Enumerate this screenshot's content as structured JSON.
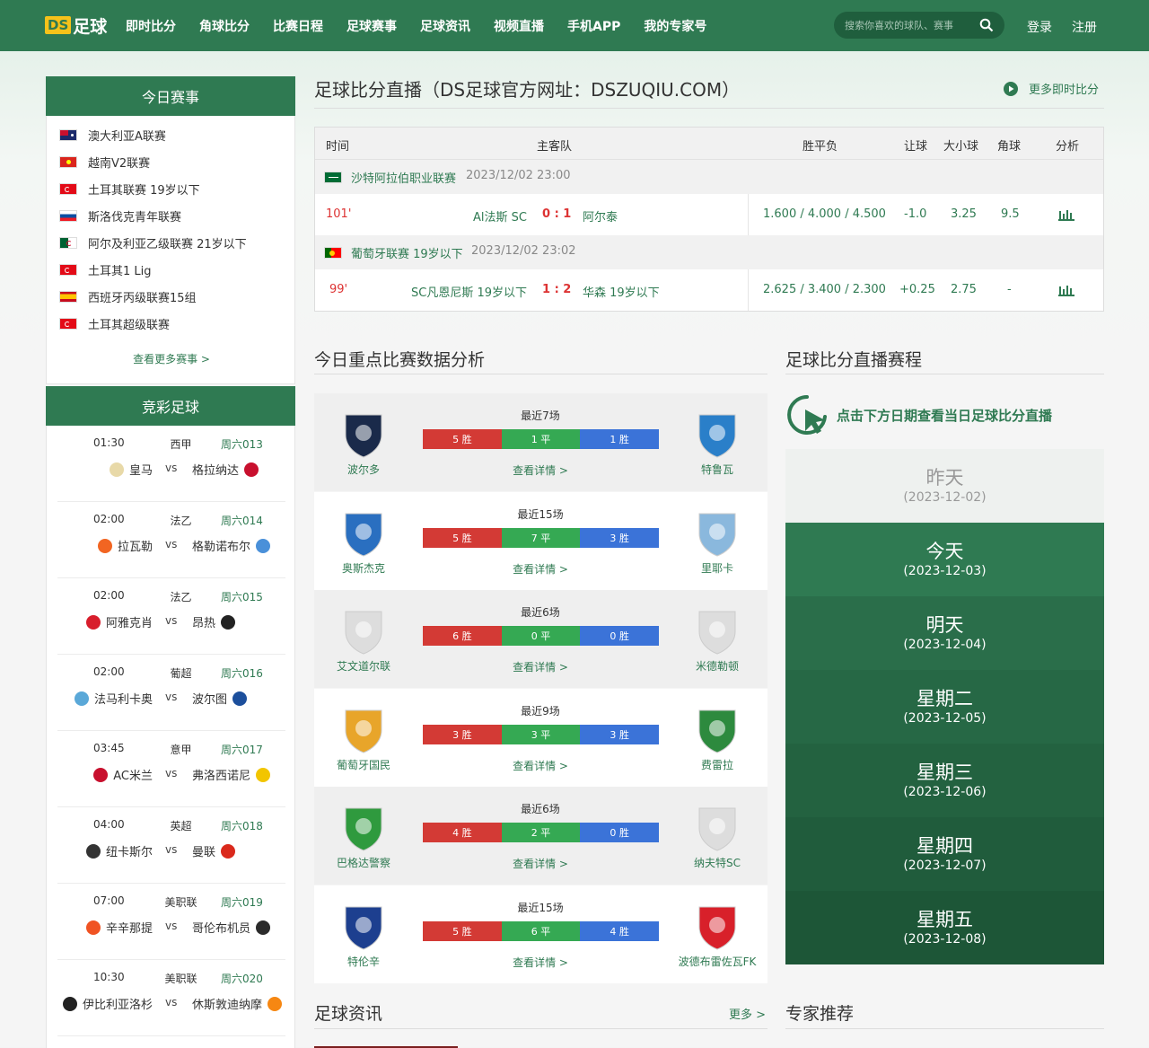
{
  "header": {
    "logo_prefix": "DS",
    "logo_text": "足球",
    "nav": [
      "即时比分",
      "角球比分",
      "比赛日程",
      "足球赛事",
      "足球资讯",
      "视频直播",
      "手机APP",
      "我的专家号"
    ],
    "search_placeholder": "搜索你喜欢的球队、赛事",
    "login": "登录",
    "register": "注册"
  },
  "today_panel": {
    "title": "今日赛事",
    "leagues": [
      {
        "name": "澳大利亚A联赛",
        "flag": "au"
      },
      {
        "name": "越南V2联赛",
        "flag": "vn"
      },
      {
        "name": "土耳其联赛 19岁以下",
        "flag": "tr"
      },
      {
        "name": "斯洛伐克青年联赛",
        "flag": "sk"
      },
      {
        "name": "阿尔及利亚乙级联赛 21岁以下",
        "flag": "dz"
      },
      {
        "name": "土耳其1 Lig",
        "flag": "tr"
      },
      {
        "name": "西班牙丙级联赛15组",
        "flag": "es"
      },
      {
        "name": "土耳其超级联赛",
        "flag": "tr"
      }
    ],
    "more": "查看更多赛事 >"
  },
  "lottery_panel": {
    "title": "竞彩足球",
    "matches": [
      {
        "time": "01:30",
        "league": "西甲",
        "no": "周六013",
        "home": "皇马",
        "away": "格拉纳达",
        "hc": "#e8d9a8",
        "ac": "#c8102e"
      },
      {
        "time": "02:00",
        "league": "法乙",
        "no": "周六014",
        "home": "拉瓦勒",
        "away": "格勒诺布尔",
        "hc": "#f26522",
        "ac": "#4a90d9"
      },
      {
        "time": "02:00",
        "league": "法乙",
        "no": "周六015",
        "home": "阿雅克肖",
        "away": "昂热",
        "hc": "#d81e2c",
        "ac": "#222222"
      },
      {
        "time": "02:00",
        "league": "葡超",
        "no": "周六016",
        "home": "法马利卡奥",
        "away": "波尔图",
        "hc": "#5aa8d8",
        "ac": "#1c4f9c"
      },
      {
        "time": "03:45",
        "league": "意甲",
        "no": "周六017",
        "home": "AC米兰",
        "away": "弗洛西诺尼",
        "hc": "#c8102e",
        "ac": "#f2c500"
      },
      {
        "time": "04:00",
        "league": "英超",
        "no": "周六018",
        "home": "纽卡斯尔",
        "away": "曼联",
        "hc": "#333333",
        "ac": "#da291c"
      },
      {
        "time": "07:00",
        "league": "美职联",
        "no": "周六019",
        "home": "辛辛那提",
        "away": "哥伦布机员",
        "hc": "#f05323",
        "ac": "#2b2b2b"
      },
      {
        "time": "10:30",
        "league": "美职联",
        "no": "周六020",
        "home": "伊比利亚洛杉",
        "away": "休斯敦迪纳摩",
        "hc": "#222222",
        "ac": "#f68712"
      }
    ]
  },
  "live": {
    "title": "足球比分直播（DS足球官方网址：DSZUQIU.COM）",
    "more": "更多即时比分",
    "columns": {
      "time": "时间",
      "teams": "主客队",
      "odds": "胜平负",
      "handicap": "让球",
      "ou": "大小球",
      "corner": "角球",
      "analysis": "分析"
    },
    "groups": [
      {
        "league": "沙特阿拉伯职业联赛",
        "date": "2023/12/02 23:00",
        "flag": "sa",
        "match": {
          "minute": "101'",
          "home": "Al法斯 SC",
          "score": "0 : 1",
          "away": "阿尔泰",
          "odds": "1.600 / 4.000 / 4.500",
          "handicap": "-1.0",
          "ou": "3.25",
          "corner": "9.5"
        }
      },
      {
        "league": "葡萄牙联赛 19岁以下",
        "date": "2023/12/02 23:02",
        "flag": "pt",
        "match": {
          "minute": "99'",
          "home": "SC凡恩尼斯 19岁以下",
          "score": "1 : 2",
          "away": "华森 19岁以下",
          "odds": "2.625 / 3.400 / 2.300",
          "handicap": "+0.25",
          "ou": "2.75",
          "corner": "-"
        }
      }
    ]
  },
  "analysis": {
    "title": "今日重点比赛数据分析",
    "cards": [
      {
        "home": "波尔多",
        "away": "特鲁瓦",
        "recent": "最近7场",
        "w": "5 胜",
        "d": "1 平",
        "l": "1 胜",
        "hc": "#1a2a4a",
        "ac": "#2a7fc9",
        "detail": "查看详情 >"
      },
      {
        "home": "奥斯杰克",
        "away": "里耶卡",
        "recent": "最近15场",
        "w": "5 胜",
        "d": "7 平",
        "l": "3 胜",
        "hc": "#2a6fc0",
        "ac": "#8ab8dd",
        "detail": "查看详情 >"
      },
      {
        "home": "艾文道尔联",
        "away": "米德勒顿",
        "recent": "最近6场",
        "w": "6 胜",
        "d": "0 平",
        "l": "0 胜",
        "hc": "#dddddd",
        "ac": "#dddddd",
        "detail": "查看详情 >"
      },
      {
        "home": "葡萄牙国民",
        "away": "费雷拉",
        "recent": "最近9场",
        "w": "3 胜",
        "d": "3 平",
        "l": "3 胜",
        "hc": "#e8a52a",
        "ac": "#2d8a3e",
        "detail": "查看详情 >"
      },
      {
        "home": "巴格达警察",
        "away": "纳夫特SC",
        "recent": "最近6场",
        "w": "4 胜",
        "d": "2 平",
        "l": "0 胜",
        "hc": "#2f9a3e",
        "ac": "#dddddd",
        "detail": "查看详情 >"
      },
      {
        "home": "特伦辛",
        "away": "波德布雷佐瓦FK",
        "recent": "最近15场",
        "w": "5 胜",
        "d": "6 平",
        "l": "4 胜",
        "hc": "#1d3f8f",
        "ac": "#d8202a",
        "detail": "查看详情 >"
      }
    ]
  },
  "schedule": {
    "title": "足球比分直播赛程",
    "hint": "点击下方日期查看当日足球比分直播",
    "days": [
      {
        "label": "昨天",
        "date": "(2023-12-02)"
      },
      {
        "label": "今天",
        "date": "(2023-12-03)"
      },
      {
        "label": "明天",
        "date": "(2023-12-04)"
      },
      {
        "label": "星期二",
        "date": "(2023-12-05)"
      },
      {
        "label": "星期三",
        "date": "(2023-12-06)"
      },
      {
        "label": "星期四",
        "date": "(2023-12-07)"
      },
      {
        "label": "星期五",
        "date": "(2023-12-08)"
      }
    ]
  },
  "news": {
    "title": "足球资讯",
    "more": "更多 >"
  },
  "experts": {
    "title": "专家推荐"
  },
  "colors": {
    "primary": "#2f7a52",
    "win": "#d33a35",
    "draw": "#35a953",
    "loss": "#3b73d8"
  }
}
